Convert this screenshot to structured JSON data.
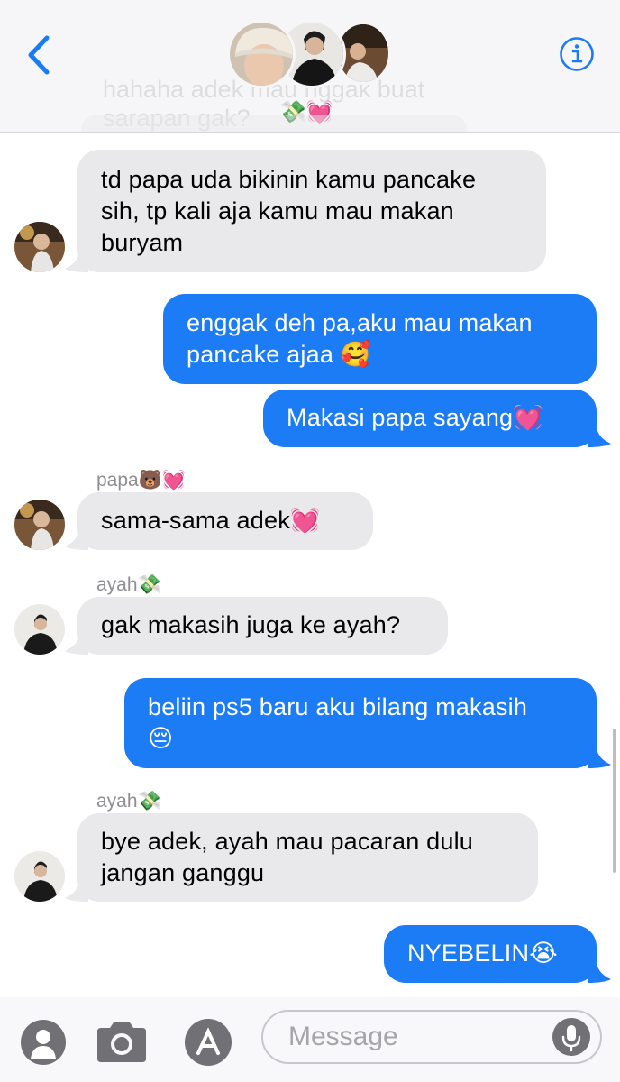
{
  "header": {
    "back_label": "<",
    "info_label": "i",
    "ghost_lines": [
      "hahaha adek mau nggak buat",
      "sarapan gak?"
    ],
    "ghost_emoji": "💸💓"
  },
  "messages": [
    {
      "type": "recv",
      "lines": [
        "td papa uda bikinin kamu pancake",
        "sih, tp kali aja kamu mau makan",
        "buryam"
      ],
      "avatar": "papa"
    },
    {
      "type": "sent",
      "lines": [
        "enggak deh pa,aku mau makan",
        "pancake ajaa 🥰"
      ]
    },
    {
      "type": "sent",
      "lines": [
        "Makasi papa sayang💓"
      ]
    },
    {
      "type": "recv",
      "sender": "papa🐻💓",
      "lines": [
        "sama-sama adek💓"
      ],
      "avatar": "papa"
    },
    {
      "type": "recv",
      "sender": "ayah💸",
      "lines": [
        "gak makasih juga ke ayah?"
      ],
      "avatar": "ayah"
    },
    {
      "type": "sent",
      "lines": [
        "beliin ps5 baru aku bilang makasih",
        "😔"
      ]
    },
    {
      "type": "recv",
      "sender": "ayah💸",
      "lines": [
        "bye adek, ayah mau pacaran dulu",
        "jangan ganggu"
      ],
      "avatar": "ayah"
    },
    {
      "type": "sent",
      "lines": [
        "NYEBELIN😭"
      ]
    }
  ],
  "composer": {
    "placeholder": "Message"
  },
  "colors": {
    "sent_bubble": "#1b7cf6",
    "recv_bubble": "#e9e9eb",
    "accent": "#1a7cf5"
  },
  "icons": [
    "chevron-left-icon",
    "info-icon",
    "contacts-icon",
    "camera-icon",
    "app-store-icon",
    "microphone-icon"
  ]
}
